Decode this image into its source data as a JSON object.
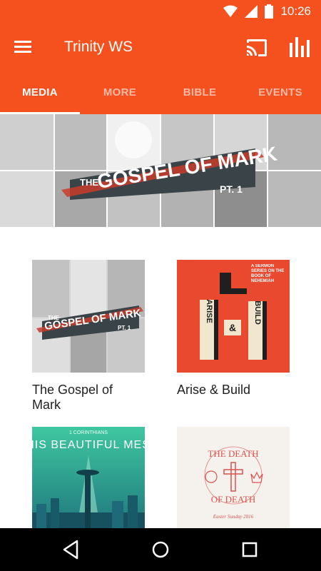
{
  "status_bar": {
    "time": "10:26"
  },
  "app_bar": {
    "title": "Trinity WS"
  },
  "tabs": [
    {
      "label": "MEDIA",
      "active": true
    },
    {
      "label": "MORE",
      "active": false
    },
    {
      "label": "BIBLE",
      "active": false
    },
    {
      "label": "EVENTS",
      "active": false
    }
  ],
  "hero": {
    "artwork": {
      "line1": "THE",
      "line2": "GOSPEL OF MARK",
      "line3": "PT. 1"
    }
  },
  "media_items": [
    {
      "title": "The Gospel of Mark",
      "art": {
        "line1": "THE",
        "line2": "GOSPEL OF MARK",
        "line3": "PT. 1"
      }
    },
    {
      "title": "Arise & Build",
      "art": {
        "subtitle": "A SERMON SERIES ON THE BOOK OF NEHEMIAH",
        "blocks_left": "ARISE",
        "block_mid": "&",
        "blocks_right": "BUILD"
      }
    },
    {
      "title": "",
      "art": {
        "line1": "1 CORINTHIANS",
        "line2": "THIS BEAUTIFUL MESS"
      }
    },
    {
      "title": "",
      "art": {
        "line1": "THE DEATH",
        "line2": "OF DEATH",
        "footer": "Easter Sunday 2016"
      }
    }
  ],
  "colors": {
    "primary": "#f4511e",
    "text": "#212121",
    "tab_inactive": "rgba(255,255,255,0.6)"
  },
  "icons": [
    "wifi-icon",
    "signal-icon",
    "battery-icon",
    "menu-icon",
    "cast-icon",
    "stats-icon",
    "back-icon",
    "home-icon",
    "recents-icon"
  ]
}
